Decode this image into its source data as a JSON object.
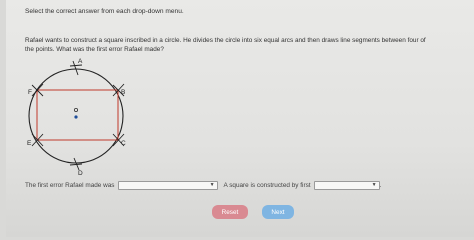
{
  "instruction": "Select the correct answer from each drop-down menu.",
  "question": {
    "line1": "Rafael wants to construct a square inscribed in a circle. He divides the circle into six equal arcs and then draws line segments between four of",
    "line2": "the points. What was the first error Rafael made?"
  },
  "figure": {
    "labels": {
      "a": "A",
      "b": "B",
      "c": "C",
      "d": "D",
      "e": "E",
      "f": "F"
    }
  },
  "answer_row": {
    "prefix": "The first error Rafael made was",
    "dropdown1_value": "",
    "middle": "A square is constructed by first",
    "dropdown2_value": "",
    "suffix": "."
  },
  "buttons": {
    "reset": "Reset",
    "next": "Next"
  },
  "colors": {
    "reset": "#d98a92",
    "next": "#7fb5e2",
    "segments": "#c0392b",
    "circle": "#222222"
  },
  "icons": {
    "dropdown": "chevron-down-icon"
  }
}
